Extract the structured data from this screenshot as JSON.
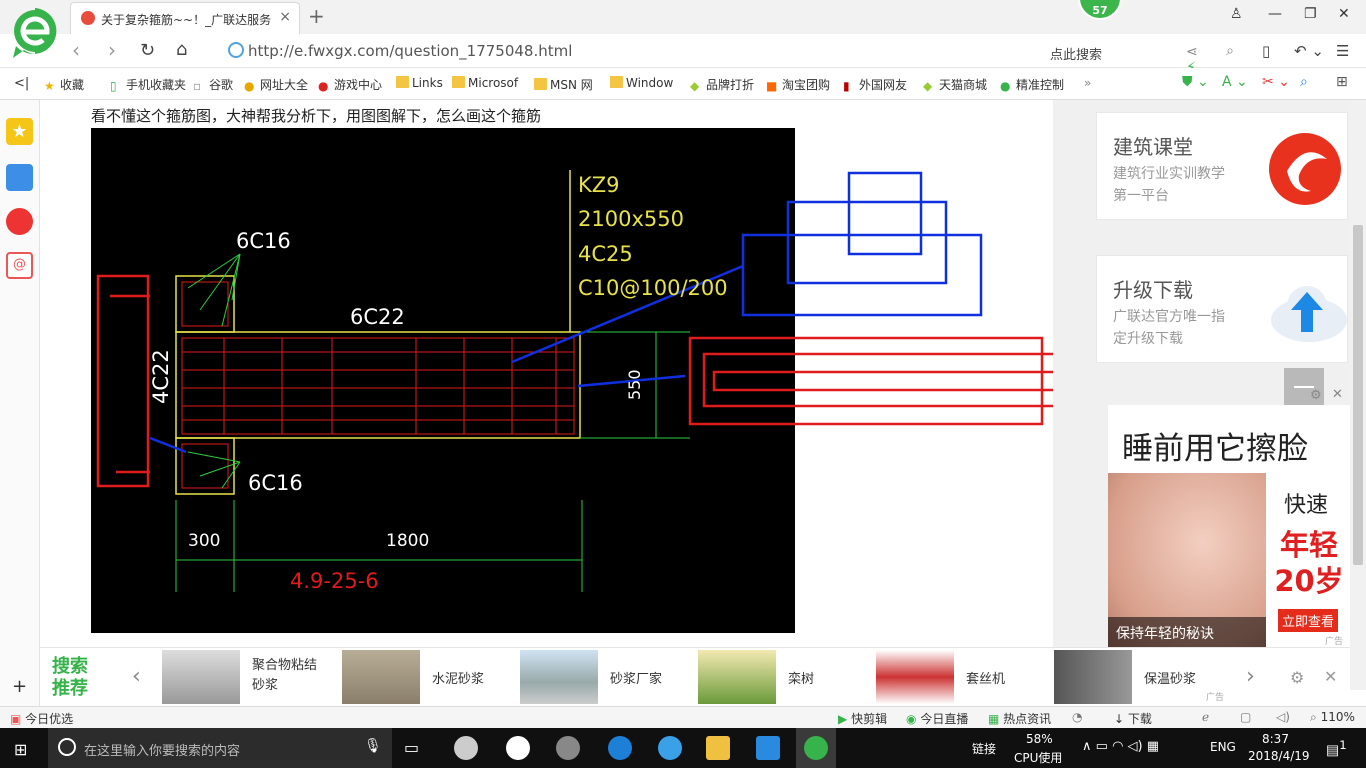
{
  "browser": {
    "tab_title": "关于复杂箍筋~~！_广联达服务新",
    "tab_close": "×",
    "new_tab": "+",
    "badge_count": "57",
    "url": "http://e.fwxgx.com/question_1775048.html",
    "search_placeholder": "点此搜索"
  },
  "bookmarks": [
    {
      "label": "收藏",
      "icon": "star-icon"
    },
    {
      "label": "手机收藏夹",
      "icon": "phone-icon"
    },
    {
      "label": "谷歌",
      "icon": "page-icon"
    },
    {
      "label": "网址大全",
      "icon": "globe-icon"
    },
    {
      "label": "游戏中心",
      "icon": "game-icon"
    },
    {
      "label": "Links",
      "icon": "folder-icon"
    },
    {
      "label": "Microsof",
      "icon": "folder-icon"
    },
    {
      "label": "MSN 网",
      "icon": "folder-icon"
    },
    {
      "label": "Window",
      "icon": "folder-icon"
    },
    {
      "label": "品牌打折",
      "icon": "tag-icon"
    },
    {
      "label": "淘宝团购",
      "icon": "taobao-icon"
    },
    {
      "label": "外国网友",
      "icon": "flag-icon"
    },
    {
      "label": "天猫商城",
      "icon": "tmall-icon"
    },
    {
      "label": "精准控制",
      "icon": "chat-icon"
    }
  ],
  "page": {
    "question": "看不懂这个箍筋图，大神帮我分析下，用图图解下，怎么画这个箍筋"
  },
  "drawing": {
    "col_name": "KZ9",
    "col_size": "2100x550",
    "col_main": "4C25",
    "col_stirrup": "C10@100/200",
    "top_flange": "6C16",
    "bottom_flange": "6C16",
    "web_label": "6C22",
    "side_label": "4C22",
    "dim_550": "550",
    "dim_300": "300",
    "dim_1800": "1800",
    "elevation": "4.9-25-6"
  },
  "ads": {
    "card1_title": "建筑课堂",
    "card1_sub": "建筑行业实训教学第一平台",
    "card2_title": "升级下载",
    "card2_sub": "广联达官方唯一指定升级下载",
    "big_title": "睡前用它擦脸",
    "big_quick": "快速",
    "big_young": "年轻20岁",
    "big_btn": "立即查看",
    "big_caption": "保持年轻的秘诀",
    "ad_tag": "广告"
  },
  "recommend": {
    "label": "搜索推荐",
    "items": [
      "聚合物粘结砂浆",
      "水泥砂浆",
      "砂浆厂家",
      "栾树",
      "套丝机",
      "保温砂浆"
    ],
    "ad_tag": "广告"
  },
  "statusbar": {
    "left": "今日优选",
    "items": [
      "快剪辑",
      "今日直播",
      "热点资讯",
      "下载"
    ],
    "zoom": "110%"
  },
  "taskbar": {
    "search_placeholder": "在这里输入你要搜索的内容",
    "link_label": "链接",
    "cpu_percent": "58%",
    "cpu_label": "CPU使用",
    "lang": "ENG",
    "time": "8:37",
    "date": "2018/4/19",
    "notif_count": "1"
  },
  "colors": {
    "accent_green": "#36b34a",
    "cad_yellow": "#e8e24a",
    "cad_red": "#e01b1b",
    "annot_blue": "#1030e0"
  }
}
